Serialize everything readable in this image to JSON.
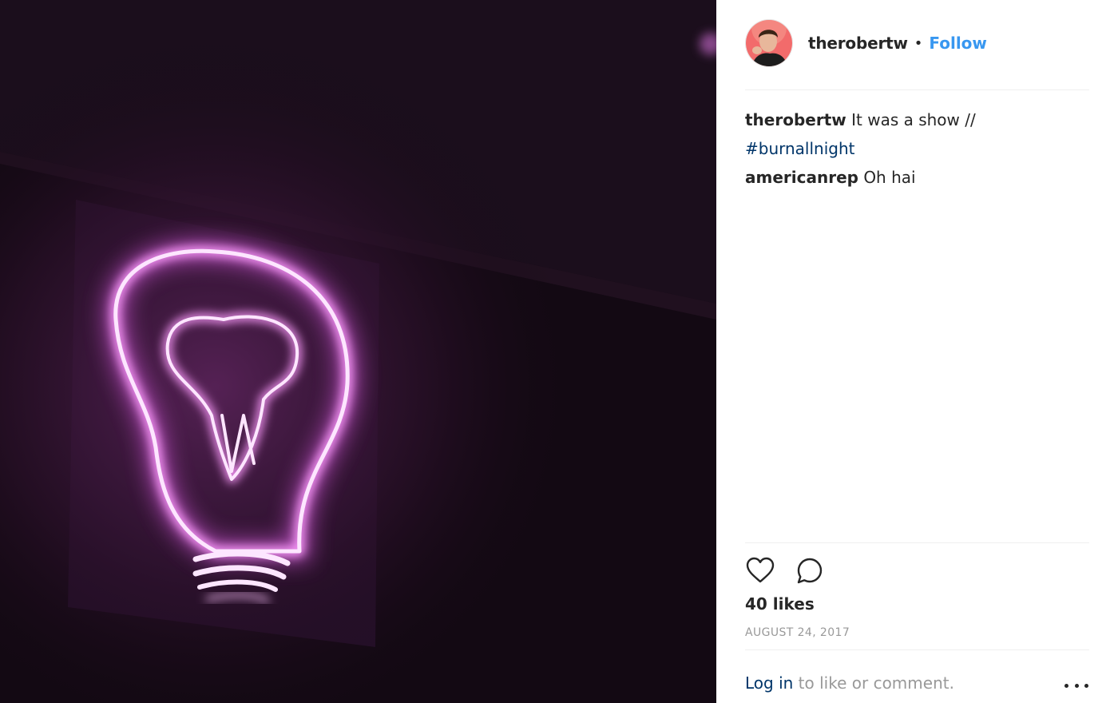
{
  "post": {
    "username": "therobertw",
    "separator": "•",
    "follow_label": "Follow",
    "photo_icon": "neon-lightbulb-photo",
    "avatar_icon": "user-avatar"
  },
  "comments": [
    {
      "user": "therobertw",
      "text": "It was a show // ",
      "hashtag": "#burnallnight"
    },
    {
      "user": "americanrep",
      "text": "Oh hai"
    }
  ],
  "actions": {
    "like_icon": "heart-icon",
    "comment_icon": "comment-icon"
  },
  "likes_text": "40 likes",
  "date_text": "AUGUST 24, 2017",
  "login": {
    "link_text": "Log in",
    "rest_text": " to like or comment.",
    "more_icon": "more-options-icon"
  },
  "colors": {
    "follow": "#3897f0",
    "hashtag": "#003569",
    "neon": "#f2a6ff"
  }
}
